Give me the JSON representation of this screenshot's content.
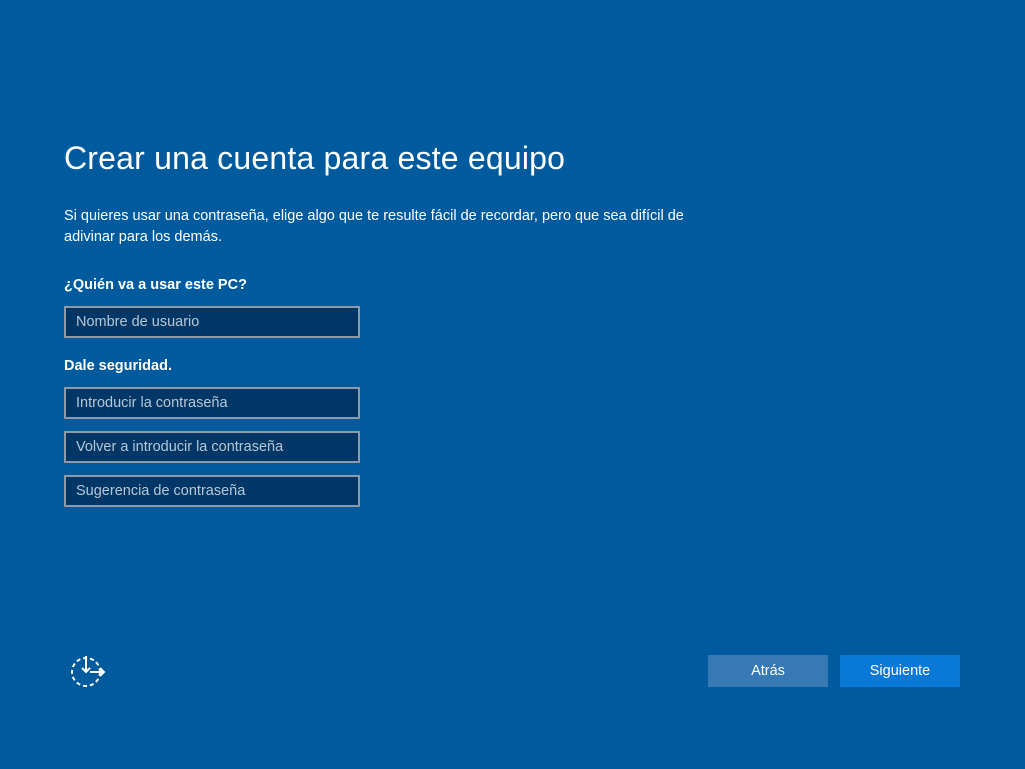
{
  "page": {
    "title": "Crear una cuenta para este equipo",
    "description": "Si quieres usar una contraseña, elige algo que te resulte fácil de recordar, pero que sea difícil de adivinar para los demás."
  },
  "user_section": {
    "label": "¿Quién va a usar este PC?",
    "username_placeholder": "Nombre de usuario",
    "username_value": ""
  },
  "security_section": {
    "label": "Dale seguridad.",
    "password_placeholder": "Introducir la contraseña",
    "password_value": "",
    "confirm_placeholder": "Volver a introducir la contraseña",
    "confirm_value": "",
    "hint_placeholder": "Sugerencia de contraseña",
    "hint_value": ""
  },
  "footer": {
    "back_label": "Atrás",
    "next_label": "Siguiente",
    "accessibility_icon": "ease-of-access-icon"
  },
  "colors": {
    "background": "#005a9e",
    "field_background": "#003766",
    "back_button": "#3679b5",
    "next_button": "#0a78d7"
  }
}
